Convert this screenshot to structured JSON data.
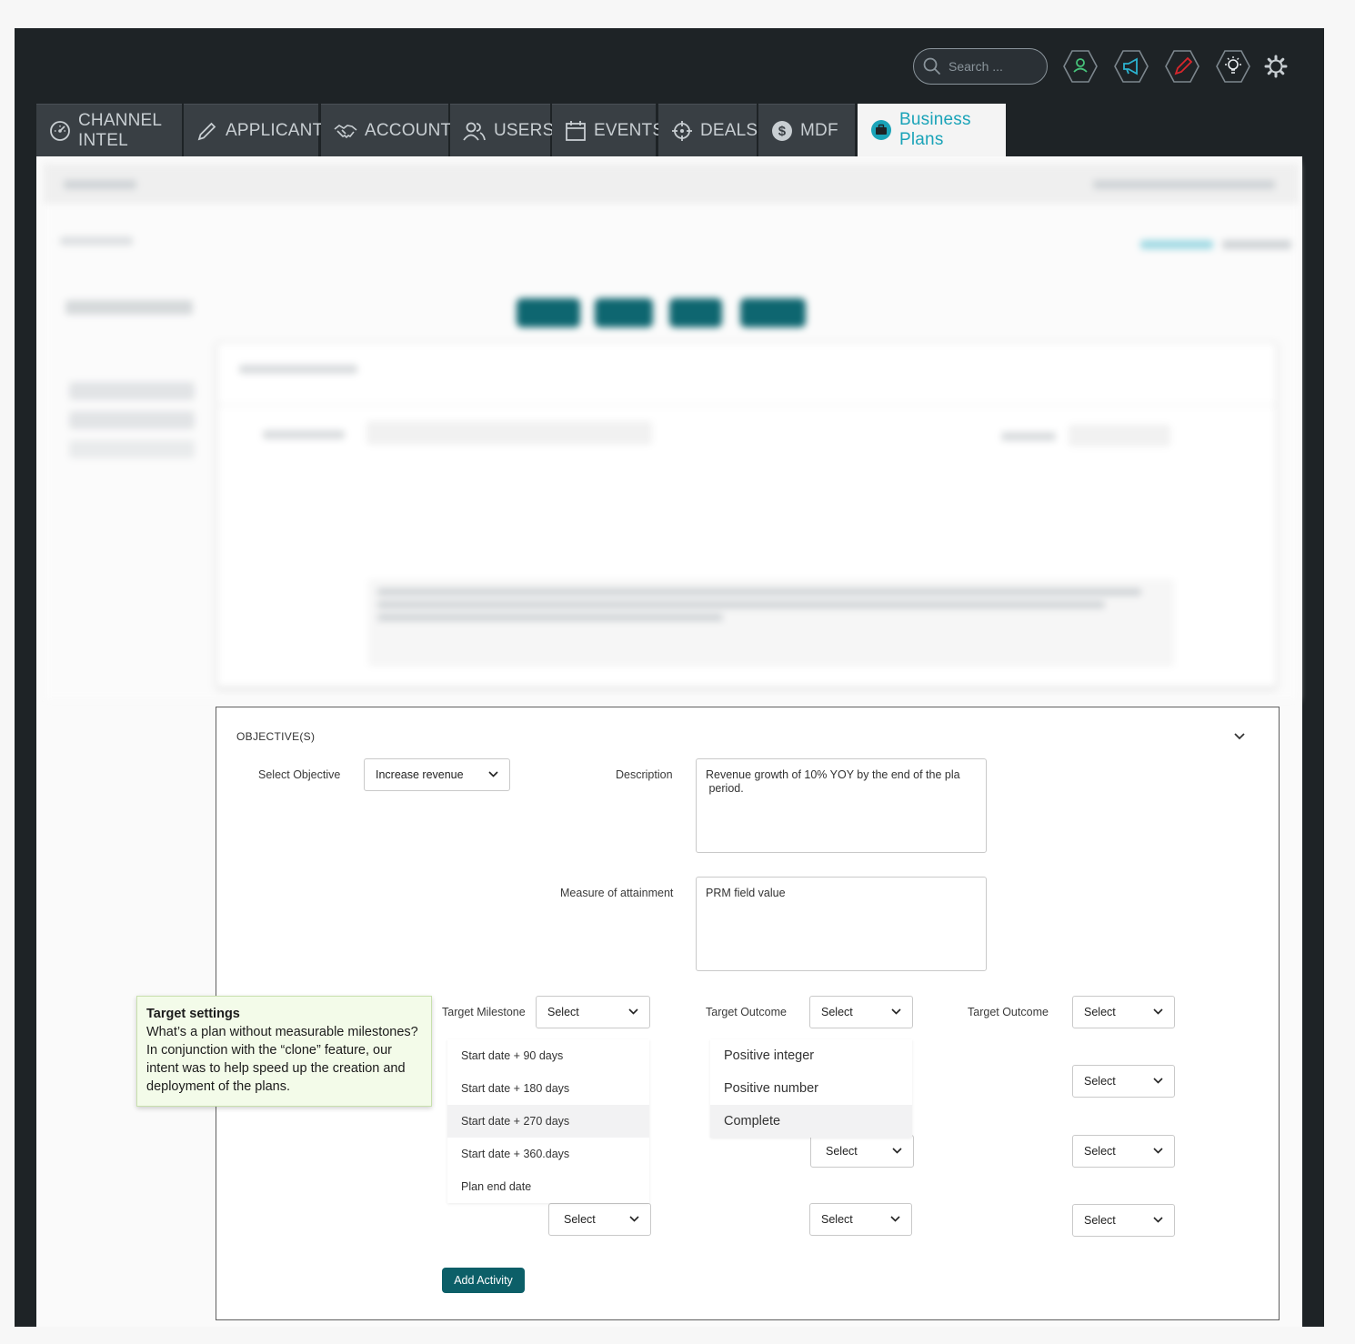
{
  "header": {
    "search_placeholder": "Search ...",
    "icons": [
      "user-icon",
      "megaphone-icon",
      "pencil-icon",
      "lightbulb-icon",
      "gear-icon"
    ]
  },
  "nav": {
    "tabs": [
      {
        "label": "CHANNEL INTEL",
        "icon": "dashboard-gauge-icon"
      },
      {
        "label": "APPLICANTS",
        "icon": "pencil-icon"
      },
      {
        "label": "ACCOUNTS",
        "icon": "handshake-icon"
      },
      {
        "label": "USERS",
        "icon": "users-icon"
      },
      {
        "label": "EVENTS",
        "icon": "calendar-icon"
      },
      {
        "label": "DEALS",
        "icon": "crosshair-icon"
      },
      {
        "label": "MDF",
        "icon": "dollar-icon"
      },
      {
        "label": "Business Plans",
        "icon": "briefcase-icon",
        "active": true
      }
    ]
  },
  "objectives": {
    "title": "OBJECTIVE(S)",
    "select_objective_label": "Select Objective",
    "select_objective_value": "Increase revenue",
    "description_label": "Description",
    "description_value": "Revenue growth of 10% YOY by the end of the pla\n period.",
    "measure_label": "Measure of attainment",
    "measure_value": "PRM field value",
    "target_milestone_label": "Target Milestone",
    "target_outcome_label_1": "Target Outcome",
    "target_outcome_label_2": "Target Outcome",
    "select_placeholder": "Select",
    "milestone_options": [
      "Start date + 90 days",
      "Start date + 180 days",
      "Start date + 270 days",
      "Start date + 360.days",
      "Plan end date"
    ],
    "outcome_options": [
      "Positive integer",
      "Positive number",
      "Complete"
    ],
    "add_activity_label": "Add Activity"
  },
  "note": {
    "title": "Target settings",
    "body": "What’s a plan without measurable milestones? In conjunction with the “clone” feature, our intent was to help speed up the creation and deployment of the plans."
  },
  "colors": {
    "frame": "#1e2326",
    "tab_bg": "#393f44",
    "active_tab_text": "#1aa3b8",
    "primary_button": "#0c5f68",
    "note_bg": "#f3fbe9"
  }
}
